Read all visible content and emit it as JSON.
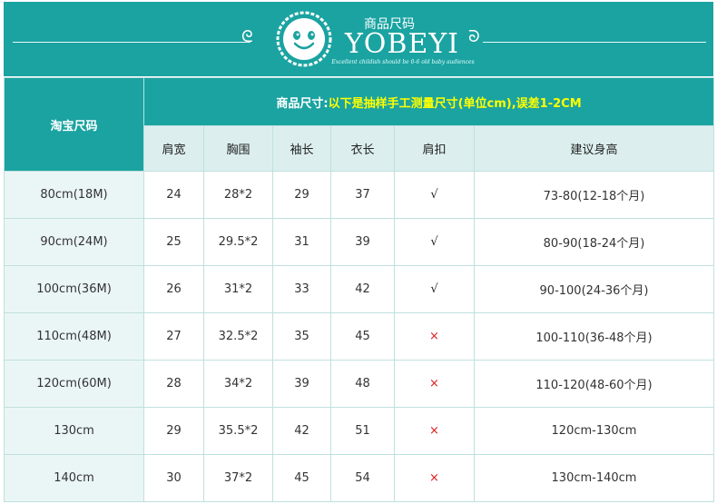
{
  "banner": {
    "brand_cn": "商品尺码",
    "brand_name": "YOBEYI",
    "slogan": "Excellent childish should be 0-6 old baby audiences"
  },
  "table": {
    "left_header": "淘宝尺码",
    "title_prefix": "商品尺寸:",
    "title_note": "以下是抽样手工测量尺寸(单位cm),误差1-2CM",
    "columns": [
      "肩宽",
      "胸围",
      "袖长",
      "衣长",
      "肩扣",
      "建议身高"
    ],
    "rows": [
      {
        "size": "80cm(18M)",
        "shoulder": "24",
        "chest": "28*2",
        "sleeve": "29",
        "length": "37",
        "button": "√",
        "button_type": "check",
        "height": "73-80(12-18个月)"
      },
      {
        "size": "90cm(24M)",
        "shoulder": "25",
        "chest": "29.5*2",
        "sleeve": "31",
        "length": "39",
        "button": "√",
        "button_type": "check",
        "height": "80-90(18-24个月)"
      },
      {
        "size": "100cm(36M)",
        "shoulder": "26",
        "chest": "31*2",
        "sleeve": "33",
        "length": "42",
        "button": "√",
        "button_type": "check",
        "height": "90-100(24-36个月)"
      },
      {
        "size": "110cm(48M)",
        "shoulder": "27",
        "chest": "32.5*2",
        "sleeve": "35",
        "length": "45",
        "button": "×",
        "button_type": "cross",
        "height": "100-110(36-48个月)"
      },
      {
        "size": "120cm(60M)",
        "shoulder": "28",
        "chest": "34*2",
        "sleeve": "39",
        "length": "48",
        "button": "×",
        "button_type": "cross",
        "height": "110-120(48-60个月)"
      },
      {
        "size": "130cm",
        "shoulder": "29",
        "chest": "35.5*2",
        "sleeve": "42",
        "length": "51",
        "button": "×",
        "button_type": "cross",
        "height": "120cm-130cm"
      },
      {
        "size": "140cm",
        "shoulder": "30",
        "chest": "37*2",
        "sleeve": "45",
        "length": "54",
        "button": "×",
        "button_type": "cross",
        "height": "130cm-140cm"
      }
    ]
  },
  "colors": {
    "teal": "#1aa3a1",
    "subheader_bg": "#dcefee",
    "row_label_bg": "#eaf6f5",
    "title_highlight": "#ffff00",
    "cross": "#e01c1c"
  }
}
